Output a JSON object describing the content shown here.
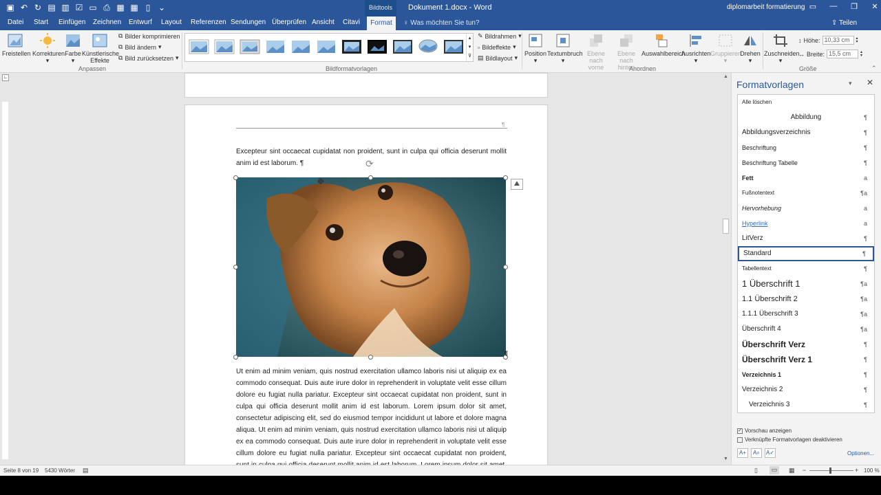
{
  "title_bar": {
    "context_tab": "Bildtools",
    "doc_title": "Dokument 1.docx  -  Word",
    "doc_name": "diplomarbeit formatierung",
    "window_controls": [
      "▭",
      "—",
      "❐",
      "✕"
    ]
  },
  "tabs": [
    "Datei",
    "Start",
    "Einfügen",
    "Zeichnen",
    "Entwurf",
    "Layout",
    "Referenzen",
    "Sendungen",
    "Überprüfen",
    "Ansicht",
    "Citavi",
    "Format"
  ],
  "tell_me": "Was möchten Sie tun?",
  "share": "Teilen",
  "ribbon": {
    "freistellen": "Freistellen",
    "korrekturen": "Korrekturen",
    "farbe": "Farbe",
    "kuenstlerische": "Künstlerische",
    "effekte": "Effekte",
    "bilder_komprimieren": "Bilder komprimieren",
    "bild_aendern": "Bild ändern",
    "bild_zuruecksetzen": "Bild zurücksetzen",
    "group_anpassen": "Anpassen",
    "group_bildformatvorlagen": "Bildformatvorlagen",
    "bildrahmen": "Bildrahmen",
    "bildeffekte": "Bildeffekte",
    "bildlayout": "Bildlayout",
    "position": "Position",
    "textumbruch": "Textumbruch",
    "ebene_vorne_1": "Ebene nach",
    "ebene_vorne_2": "vorne",
    "ebene_hinten_1": "Ebene nach",
    "ebene_hinten_2": "hinten",
    "auswahlbereich": "Auswahlbereich",
    "ausrichten": "Ausrichten",
    "gruppieren": "Gruppieren",
    "drehen": "Drehen",
    "group_anordnen": "Anordnen",
    "zuschneiden": "Zuschneiden",
    "hoehe_label": "Höhe:",
    "hoehe_value": "10,33 cm",
    "breite_label": "Breite:",
    "breite_value": "15,5 cm",
    "group_groesse": "Größe"
  },
  "document": {
    "para1": "Excepteur sint occaecat cupidatat non proident, sunt in culpa qui officia deserunt mollit anim id est laborum. ¶",
    "para2": "Ut enim ad minim veniam, quis nostrud exercitation ullamco laboris nisi ut aliquip ex ea commodo consequat. Duis aute irure dolor in reprehenderit in voluptate velit esse cillum dolore eu fugiat nulla pariatur. Excepteur sint occaecat cupidatat non proident, sunt in culpa qui officia deserunt mollit anim id est laborum. Lorem ipsum dolor sit amet, consectetur adipiscing elit, sed do eiusmod tempor incididunt ut labore et dolore magna aliqua. Ut enim ad minim veniam, quis nostrud exercitation ullamco laboris nisi ut aliquip ex ea commodo consequat. Duis aute irure dolor in reprehenderit in voluptate velit esse cillum dolore eu fugiat nulla pariatur. Excepteur sint occaecat cupidatat non proident, sunt in culpa qui officia deserunt mollit anim id est laborum. Lorem ipsum dolor sit amet, consectetur adipiscing elit",
    "pilcrow": "¶"
  },
  "styles_pane": {
    "title": "Formatvorlagen",
    "clear_all": "Alle löschen",
    "items": [
      {
        "label": "Abbildung",
        "mark": "¶"
      },
      {
        "label": "Abbildungsverzeichnis",
        "mark": "¶"
      },
      {
        "label": "Beschriftung",
        "mark": "¶"
      },
      {
        "label": "Beschriftung Tabelle",
        "mark": "¶"
      },
      {
        "label": "Fett",
        "mark": "a"
      },
      {
        "label": "Fußnotentext",
        "mark": "¶a"
      },
      {
        "label": "Hervorhebung",
        "mark": "a"
      },
      {
        "label": "Hyperlink",
        "mark": "a"
      },
      {
        "label": "LitVerz",
        "mark": "¶"
      },
      {
        "label": "Standard",
        "mark": "¶"
      },
      {
        "label": "Tabellentext",
        "mark": "¶"
      },
      {
        "label": "1  Überschrift 1",
        "mark": "¶a"
      },
      {
        "label": "1.1  Überschrift 2",
        "mark": "¶a"
      },
      {
        "label": "1.1.1  Überschrift 3",
        "mark": "¶a"
      },
      {
        "label": "Überschrift 4",
        "mark": "¶a"
      },
      {
        "label": "Überschrift Verz",
        "mark": "¶"
      },
      {
        "label": "Überschrift Verz 1",
        "mark": "¶"
      },
      {
        "label": "Verzeichnis 1",
        "mark": "¶"
      },
      {
        "label": "Verzeichnis 2",
        "mark": "¶"
      },
      {
        "label": "Verzeichnis 3",
        "mark": "¶"
      }
    ],
    "selected": "Standard",
    "vorschau": "Vorschau anzeigen",
    "vorschau_checked": true,
    "verknuepfte": "Verknüpfte Formatvorlagen deaktivieren",
    "verknuepfte_checked": false,
    "optionen": "Optionen..."
  },
  "status": {
    "page": "Seite 8 von 19",
    "words": "5430 Wörter",
    "zoom": "100 %"
  },
  "colors": {
    "accent": "#2b579a"
  }
}
